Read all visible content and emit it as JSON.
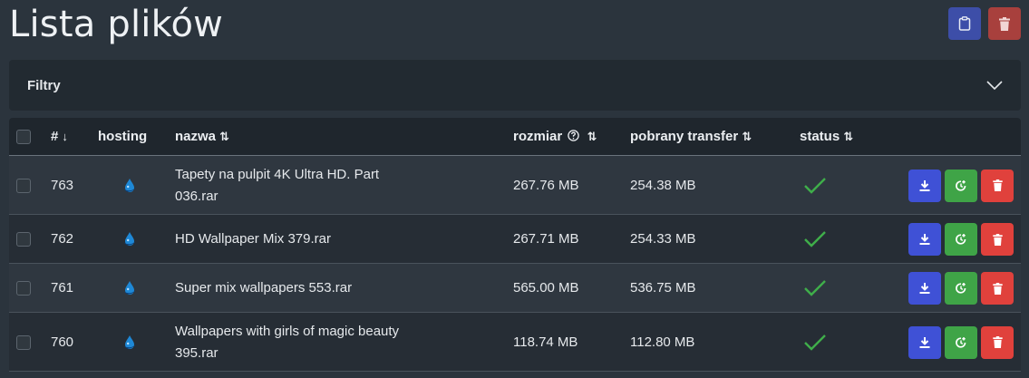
{
  "page": {
    "title": "Lista plików"
  },
  "toolbar": {
    "clipboard_icon": "clipboard-icon",
    "delete_icon": "trash-icon"
  },
  "filters": {
    "label": "Filtry"
  },
  "table": {
    "headers": {
      "id": "#",
      "id_sort": "↓",
      "hosting": "hosting",
      "name": "nazwa",
      "size": "rozmiar",
      "transfer": "pobrany transfer",
      "status": "status",
      "sort_both": "⇅"
    },
    "rows": [
      {
        "id": "763",
        "name_line1": "Tapety na pulpit 4K Ultra HD. Part",
        "name_line2": "036.rar",
        "size": "267.76 MB",
        "transfer": "254.38 MB",
        "status": "ok"
      },
      {
        "id": "762",
        "name_line1": "HD Wallpaper Mix 379.rar",
        "name_line2": "",
        "size": "267.71 MB",
        "transfer": "254.33 MB",
        "status": "ok"
      },
      {
        "id": "761",
        "name_line1": "Super mix wallpapers 553.rar",
        "name_line2": "",
        "size": "565.00 MB",
        "transfer": "536.75 MB",
        "status": "ok"
      },
      {
        "id": "760",
        "name_line1": "Wallpapers with girls of magic beauty",
        "name_line2": "395.rar",
        "size": "118.74 MB",
        "transfer": "112.80 MB",
        "status": "ok"
      }
    ]
  },
  "colors": {
    "download": "#3f51d6",
    "refresh": "#3fa447",
    "delete": "#e0413c",
    "check": "#3fae4a"
  }
}
